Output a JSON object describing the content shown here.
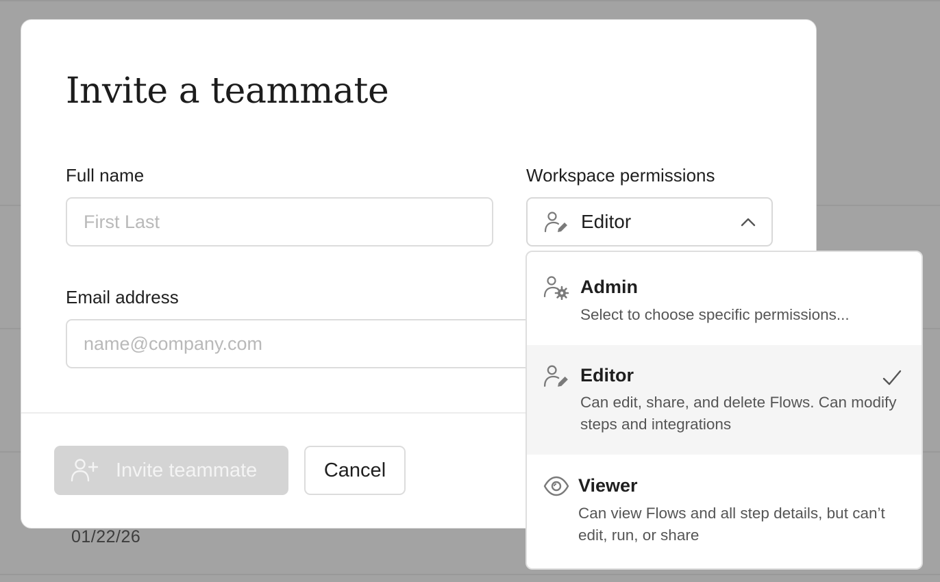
{
  "background": {
    "date": "01/22/26"
  },
  "modal": {
    "title": "Invite a teammate",
    "full_name": {
      "label": "Full name",
      "placeholder": "First Last",
      "value": ""
    },
    "email": {
      "label": "Email address",
      "placeholder": "name@company.com",
      "value": ""
    },
    "permissions": {
      "label": "Workspace permissions",
      "selected": "Editor",
      "icon": "user-edit-icon",
      "open": true,
      "options": [
        {
          "title": "Admin",
          "description": "Select to choose specific permissions...",
          "icon": "user-gear-icon",
          "selected": false
        },
        {
          "title": "Editor",
          "description": "Can edit, share, and delete Flows. Can modify steps and integrations",
          "icon": "user-edit-icon",
          "selected": true
        },
        {
          "title": "Viewer",
          "description": "Can view Flows and all step details, but can’t edit, run, or share",
          "icon": "eye-icon",
          "selected": false
        }
      ]
    },
    "actions": {
      "invite_label": "Invite teammate",
      "invite_enabled": false,
      "cancel_label": "Cancel"
    }
  },
  "colors": {
    "overlay": "#a3a3a3",
    "disabled_button": "#d4d4d4",
    "selected_option_bg": "#f5f5f5",
    "icon_gray": "#7a7a7a"
  }
}
